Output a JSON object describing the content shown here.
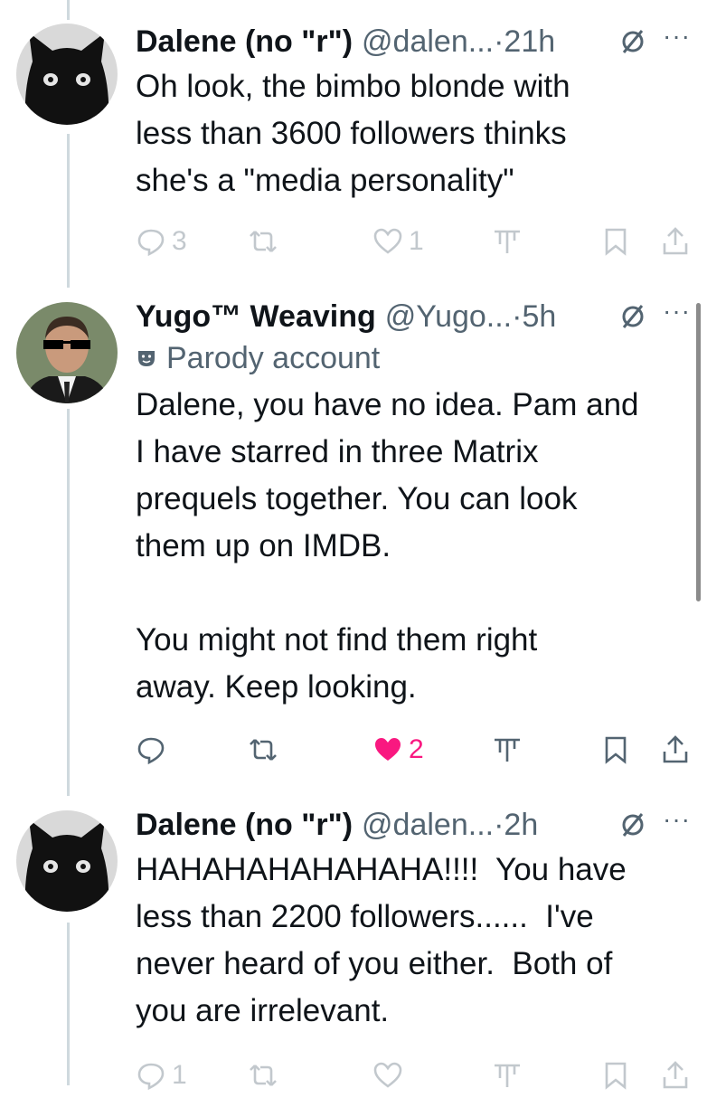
{
  "tweets": [
    {
      "name": "Dalene (no \"r\")",
      "handle": "@dalen...",
      "time": "·21h",
      "text": "Oh look, the bimbo blonde with\nless than 3600 followers thinks\nshe's a \"media personality\"",
      "replies": "3",
      "reposts": "",
      "likes": "1",
      "liked": false
    },
    {
      "name": "Yugo™ Weaving",
      "handle": "@Yugo...",
      "time": "·5h",
      "badge": "Parody account",
      "text": "Dalene, you have no idea. Pam and\nI have starred in three Matrix\nprequels together. You can look\nthem up on IMDB.\n\nYou might not find them right\naway. Keep looking.",
      "replies": "",
      "reposts": "",
      "likes": "2",
      "liked": true
    },
    {
      "name": "Dalene (no \"r\")",
      "handle": "@dalen...",
      "time": "·2h",
      "text": "HAHAHAHAHAHAHA!!!!  You have\nless than 2200 followers......  I've\nnever heard of you either.  Both of\nyou are irrelevant.",
      "replies": "1",
      "reposts": "",
      "likes": "",
      "liked": false
    }
  ],
  "more_symbol": "···",
  "colors": {
    "like_active": "#f91880",
    "secondary_text": "#536471",
    "thread_line": "#cfd9de"
  }
}
